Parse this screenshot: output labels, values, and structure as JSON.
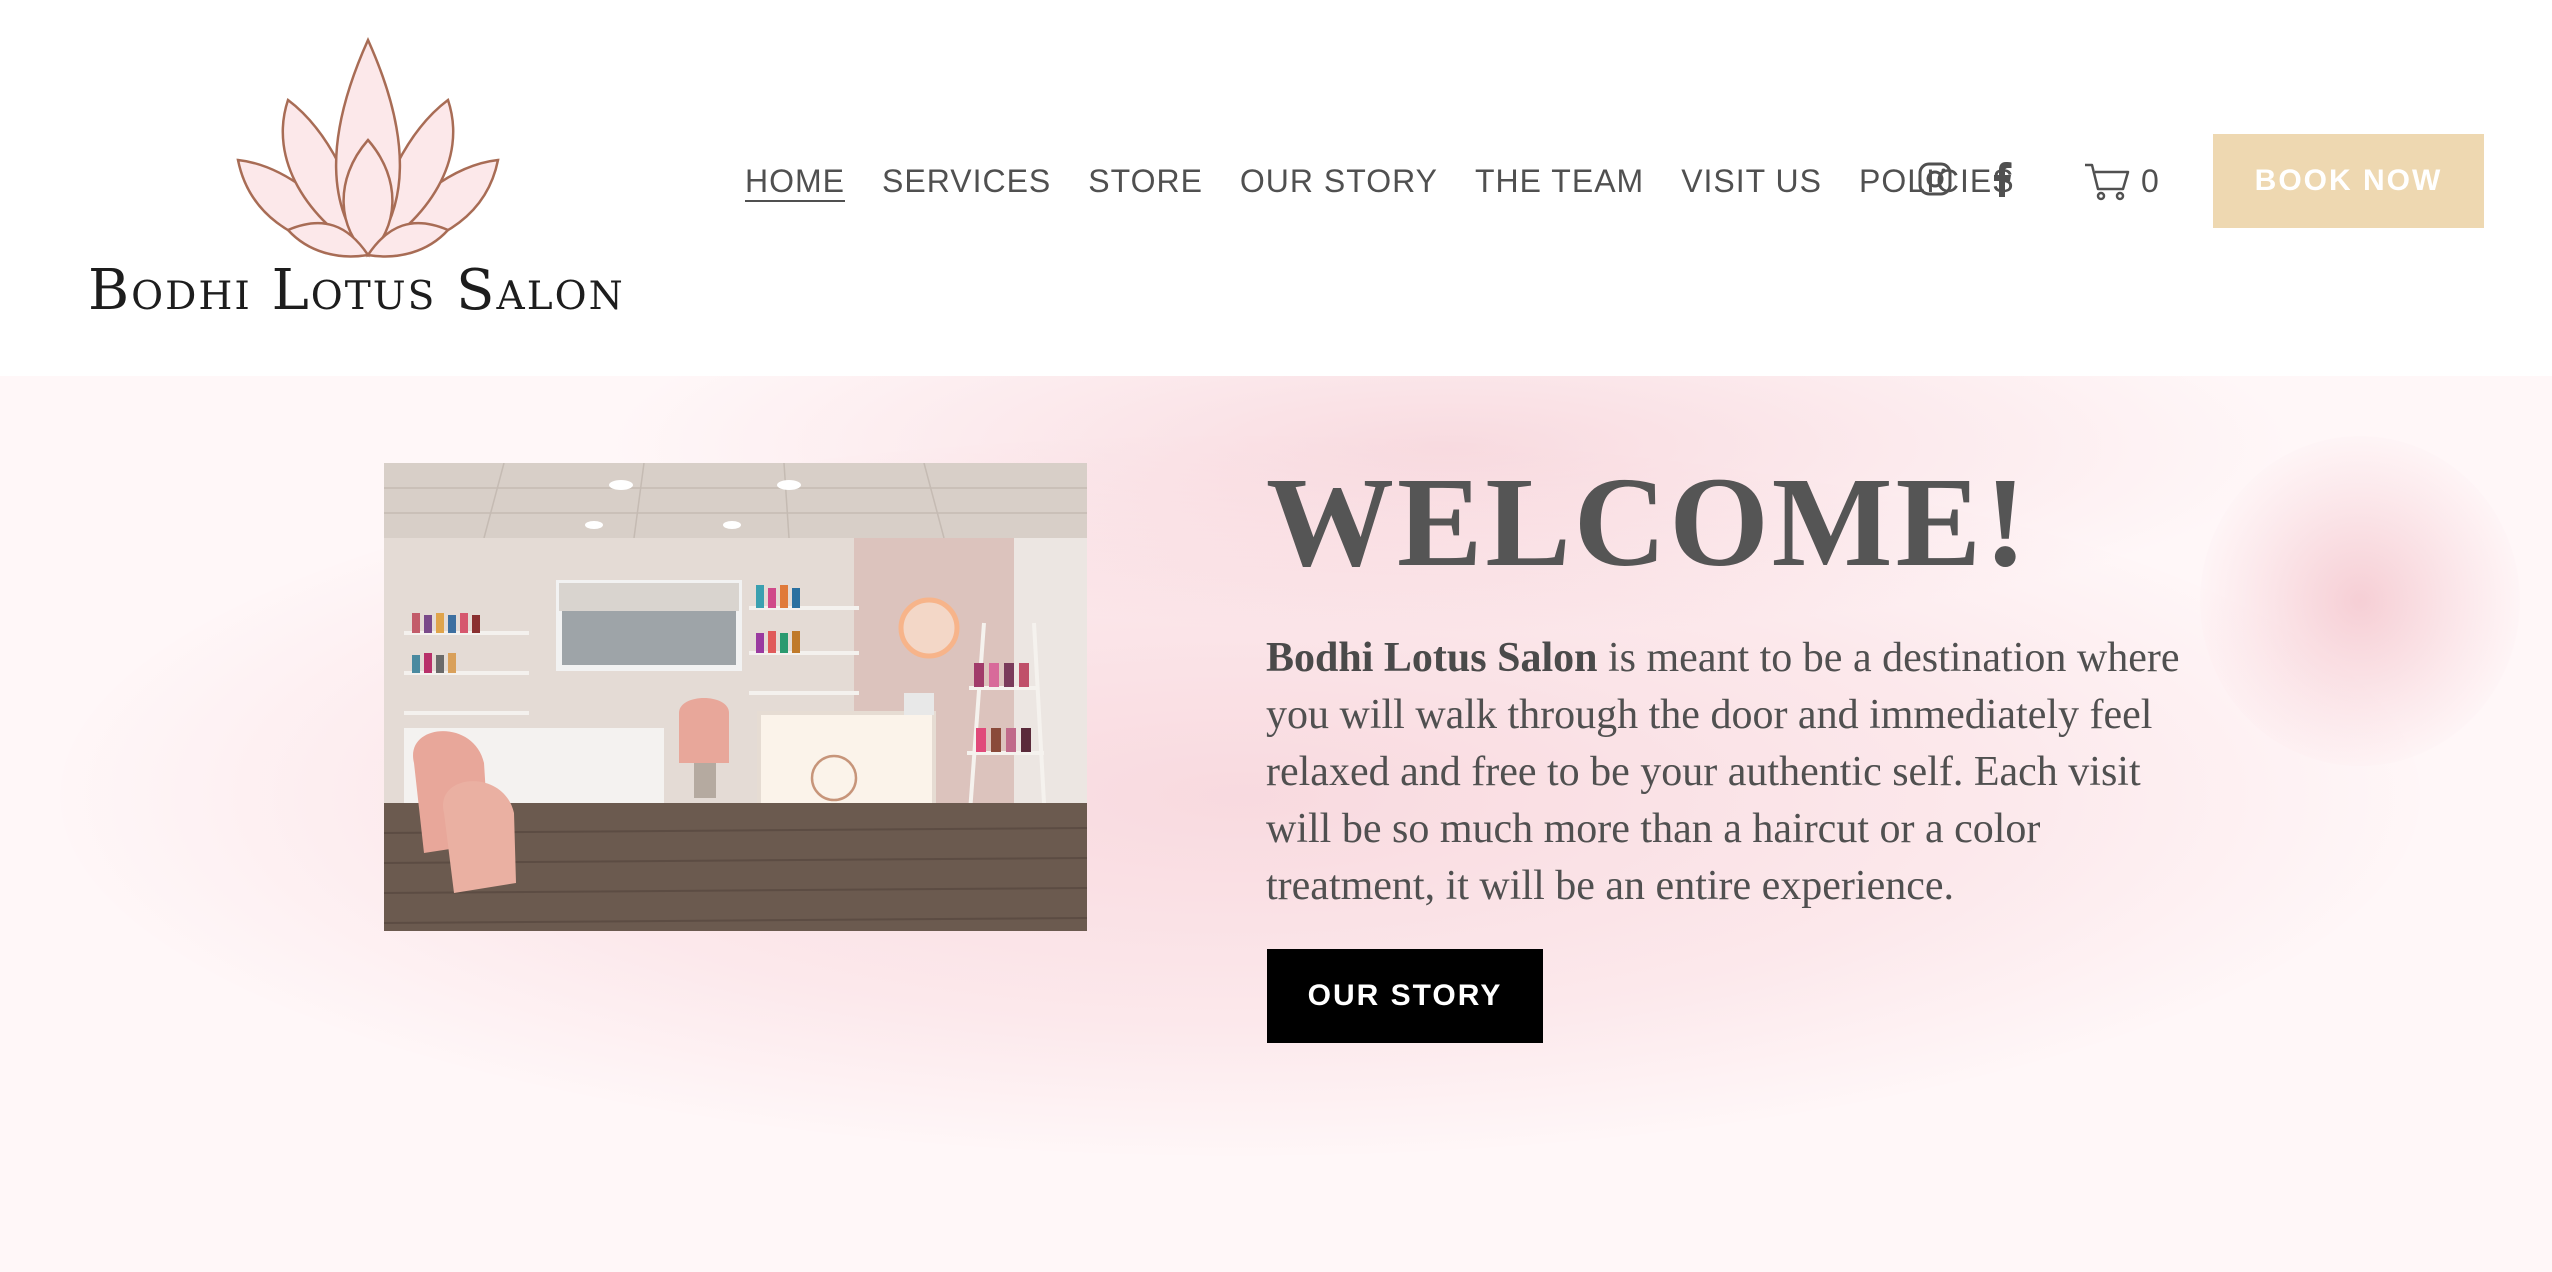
{
  "brand": {
    "name": "Bodhi Lotus Salon",
    "logo_icon": "lotus-icon"
  },
  "nav": {
    "items": [
      {
        "label": "HOME",
        "active": true
      },
      {
        "label": "SERVICES"
      },
      {
        "label": "STORE"
      },
      {
        "label": "OUR STORY"
      },
      {
        "label": "THE TEAM"
      },
      {
        "label": "VISIT US"
      },
      {
        "label": "POLICIES"
      }
    ]
  },
  "social": {
    "icons": [
      "instagram-icon",
      "facebook-icon"
    ]
  },
  "cart": {
    "icon": "cart-icon",
    "count": "0"
  },
  "book_button": {
    "label": "BOOK NOW",
    "color": "#eed8b1"
  },
  "hero": {
    "title": "WELCOME!",
    "intro_bold": "Bodhi Lotus Salon",
    "intro_rest": " is meant to be a destination where you will walk through the door and immediately feel relaxed and free to be your authentic self. Each visit will be so much more than a haircut or a color treatment, it will be an entire experience.",
    "button_label": "OUR STORY",
    "background_color": "#fff7f8",
    "accent_pink": "#f3c2cb"
  }
}
